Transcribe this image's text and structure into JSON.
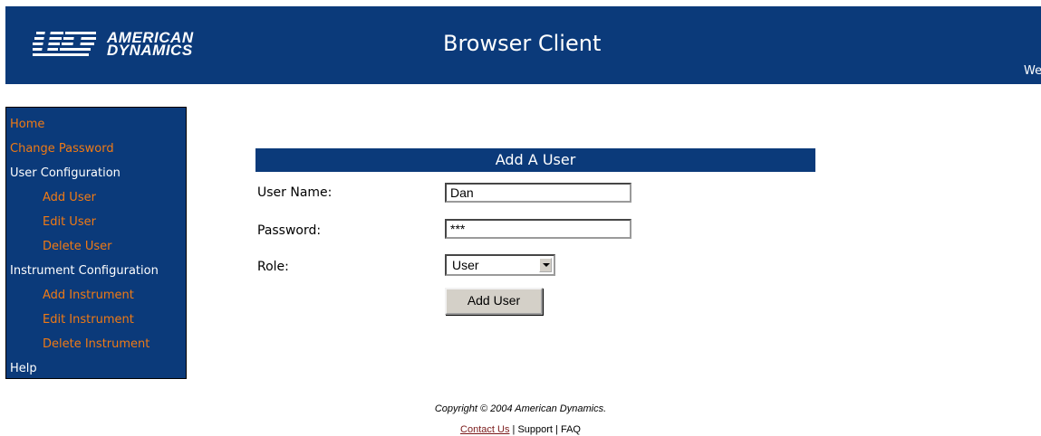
{
  "header": {
    "logo_line1": "AMERICAN",
    "logo_line2": "DYNAMICS",
    "title": "Browser Client",
    "welcome_text": "We"
  },
  "sidebar": {
    "items": [
      {
        "label": "Home"
      },
      {
        "label": "Change Password"
      },
      {
        "label": "User Configuration"
      },
      {
        "label": "Add User"
      },
      {
        "label": "Edit User"
      },
      {
        "label": "Delete User"
      },
      {
        "label": "Instrument Configuration"
      },
      {
        "label": "Add Instrument"
      },
      {
        "label": "Edit Instrument"
      },
      {
        "label": "Delete Instrument"
      },
      {
        "label": "Help"
      }
    ]
  },
  "form": {
    "title": "Add A User",
    "username_label": "User Name:",
    "username_value": "Dan",
    "password_label": "Password:",
    "password_value": "***",
    "role_label": "Role:",
    "role_value": "User",
    "submit_label": "Add User"
  },
  "footer": {
    "copyright": "Copyright © 2004 American Dynamics.",
    "contact": "Contact Us",
    "sep": " | ",
    "support": "Support",
    "faq": "FAQ"
  },
  "colors": {
    "brand_blue": "#0b3a7a",
    "link_orange": "#f07a14"
  }
}
